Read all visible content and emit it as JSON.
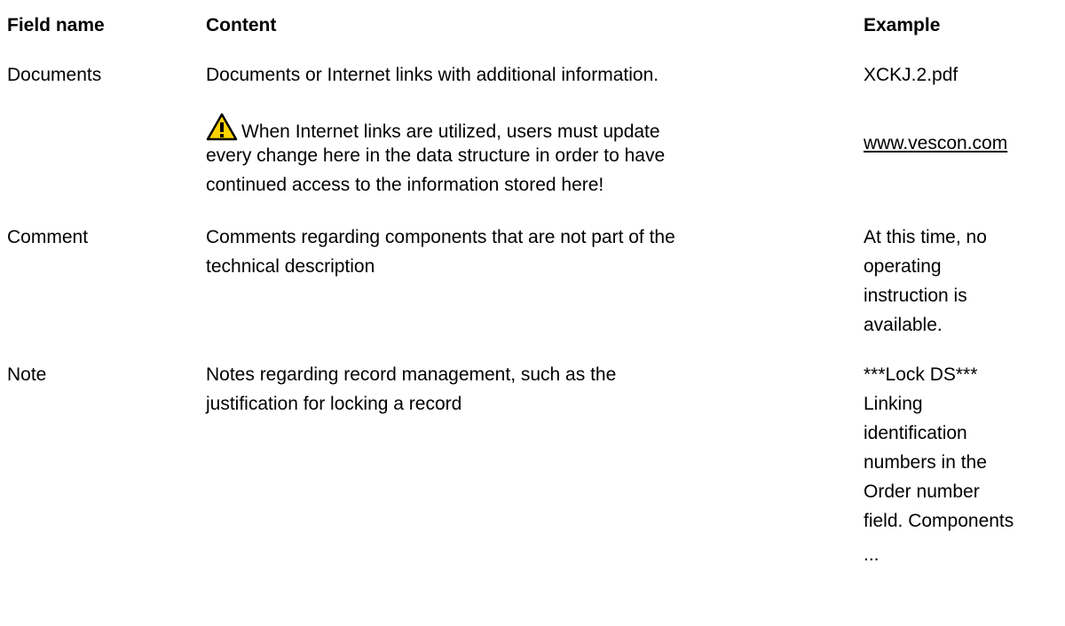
{
  "header": {
    "field_name": "Field name",
    "content": "Content",
    "example": "Example"
  },
  "rows": [
    {
      "field": "Documents",
      "content_lines": [
        "Documents or Internet links with additional information."
      ],
      "warning_lines": [
        "When Internet links are utilized, users must update",
        "every change here in the data structure in order to have",
        "continued access to the information stored here!"
      ],
      "example_lines": [
        "XCKJ.2.pdf"
      ],
      "example_link": "www.vescon.com"
    },
    {
      "field": "Comment",
      "content_lines": [
        "Comments regarding components that are not part of the",
        "technical description"
      ],
      "example_lines": [
        "At this time, no",
        "operating",
        "instruction is",
        "available."
      ]
    },
    {
      "field": "Note",
      "content_lines": [
        "Notes regarding record management, such as the",
        "justification for locking a record"
      ],
      "example_lines": [
        "***Lock DS***",
        "Linking",
        "identification",
        "numbers in the",
        "Order number",
        "field. Components",
        "..."
      ]
    }
  ],
  "icons": {
    "warning": "warning-triangle-icon"
  },
  "colors": {
    "warning_fill": "#ffd200",
    "warning_stroke": "#000000"
  }
}
